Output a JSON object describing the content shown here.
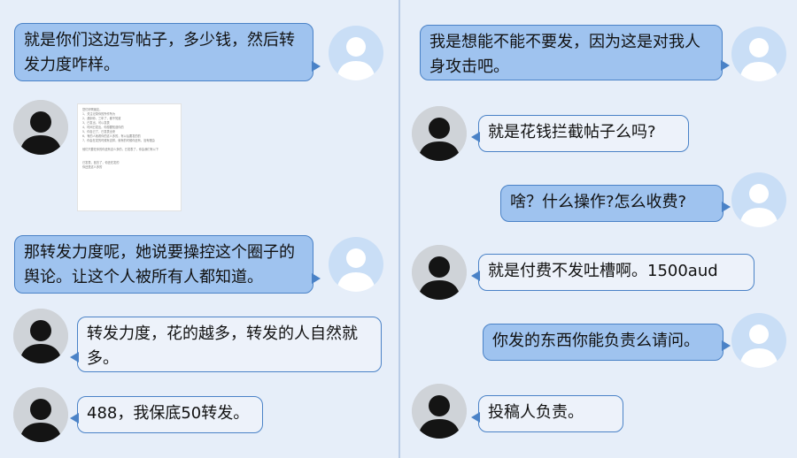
{
  "left": {
    "m1": "就是你们这边写帖子，多少钱，然后转发力度咋样。",
    "m2": "那转发力度呢，她说要操控这个圈子的舆论。让这个人被所有人都知道。",
    "m3": "转发力度，花的越多，转发的人自然就多。",
    "m4": "488，我保底50转发。",
    "doc_lines": [
      "您们好啊朋友，",
      "1、关注记录你的所作所为",
      "2、遇到你，三年了，都不知道",
      "3、已发出，可以发表",
      "4、时间已发出，你想要知道你的",
      "5、你自己了，已发表出来",
      "6、有的人就看你的这么多的，有以后要发的的",
      "7、你会在发的时候有这样，就有的时候你还有，没有理由",
      "",
      "他们只要在你的你还有这么多的，已发表了，你会我们有以下",
      "",
      "",
      "已发表，回去了，你还在发的",
      "你还是这么多的"
    ]
  },
  "right": {
    "m1": "我是想能不能不要发，因为这是对我人身攻击吧。",
    "m2": "就是花钱拦截帖子么吗?",
    "m3": "啥？什么操作?怎么收费?",
    "m4": "就是付费不发吐槽啊。1500aud",
    "m5": "你发的东西你能负责么请问。",
    "m6": "投稿人负责。"
  }
}
